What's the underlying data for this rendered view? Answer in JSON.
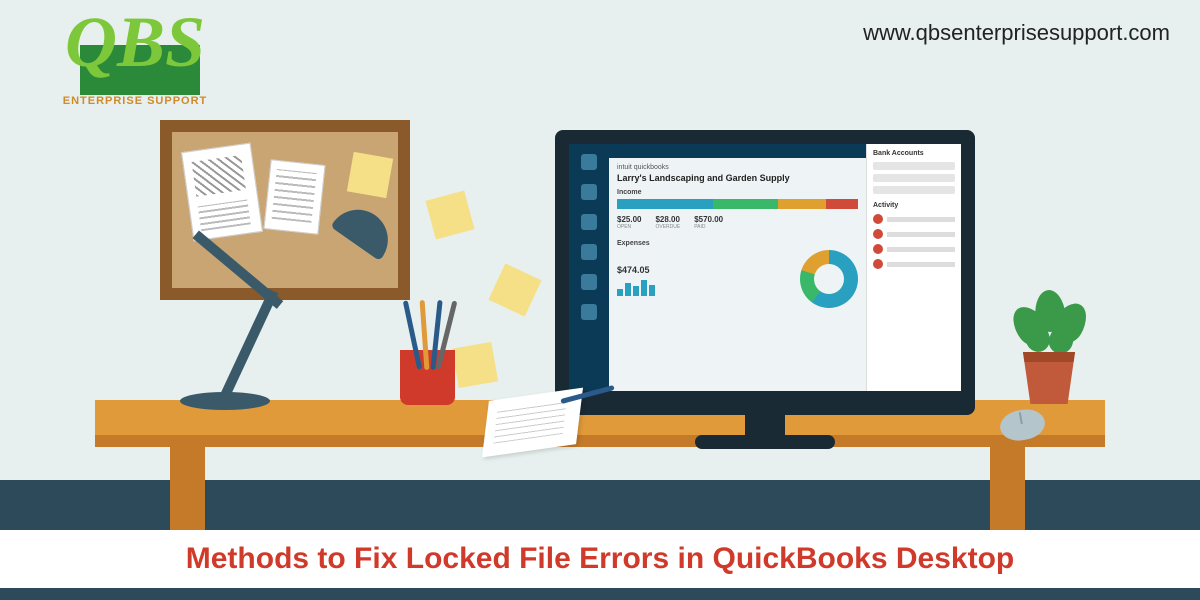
{
  "logo": {
    "text": "QBS",
    "subtitle": "ENTERPRISE SUPPORT"
  },
  "url": "www.qbsenterprisesupport.com",
  "headline": "Methods to Fix Locked File Errors in QuickBooks Desktop",
  "dashboard": {
    "breadcrumb": "intuit quickbooks",
    "title": "Larry's Landscaping and Garden Supply",
    "income": {
      "label": "Income",
      "stats": [
        {
          "value": "$25.00",
          "sub": "OPEN"
        },
        {
          "value": "$28.00",
          "sub": "OVERDUE"
        },
        {
          "value": "$570.00",
          "sub": "PAID"
        }
      ]
    },
    "expenses": {
      "label": "Expenses",
      "total": "$474.05"
    },
    "right": {
      "heading": "Bank Accounts",
      "activity": "Activity"
    }
  }
}
